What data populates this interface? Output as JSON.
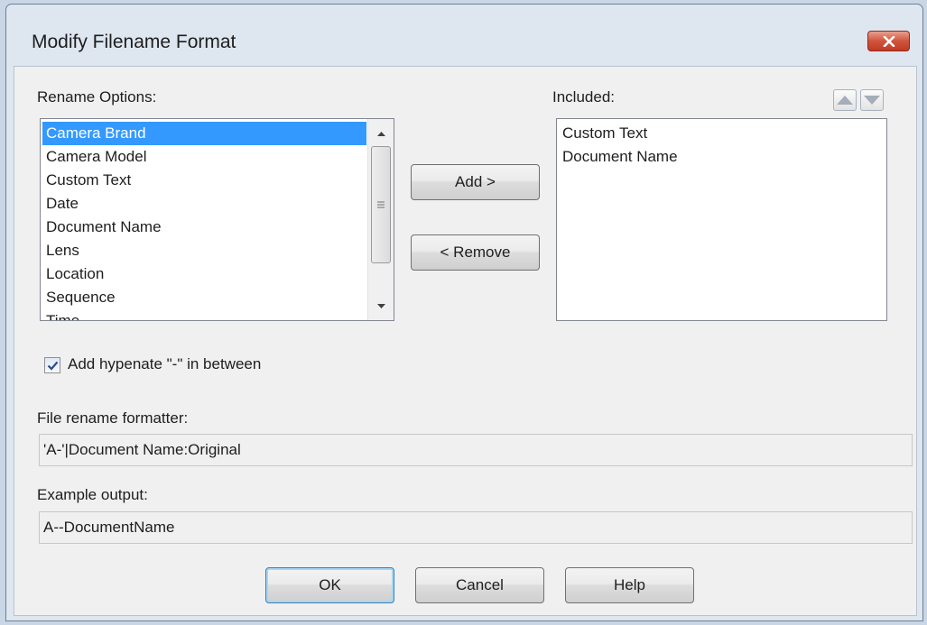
{
  "window": {
    "title": "Modify Filename Format"
  },
  "rename_options": {
    "label": "Rename Options:",
    "items": [
      "Camera Brand",
      "Camera Model",
      "Custom Text",
      "Date",
      "Document Name",
      "Lens",
      "Location",
      "Sequence",
      "Time"
    ],
    "selected": "Camera Brand"
  },
  "buttons": {
    "add": "Add >",
    "remove": "< Remove",
    "ok": "OK",
    "cancel": "Cancel",
    "help": "Help"
  },
  "included": {
    "label": "Included:",
    "items": [
      "Custom Text",
      "Document Name"
    ]
  },
  "hyphenate": {
    "label": "Add hypenate \"-\" in between",
    "checked": true
  },
  "formatter": {
    "label": "File rename formatter:",
    "value": "'A-'|Document Name:Original"
  },
  "example": {
    "label": "Example output:",
    "value": "A--DocumentName"
  },
  "colors": {
    "selection": "#3399ff",
    "close_button": "#c8452d",
    "dialog_frame": "#dee6f0"
  },
  "icons": {
    "close": "close-x-icon",
    "move_up": "triangle-up-icon",
    "move_down": "triangle-down-icon",
    "check": "checkmark-icon"
  }
}
